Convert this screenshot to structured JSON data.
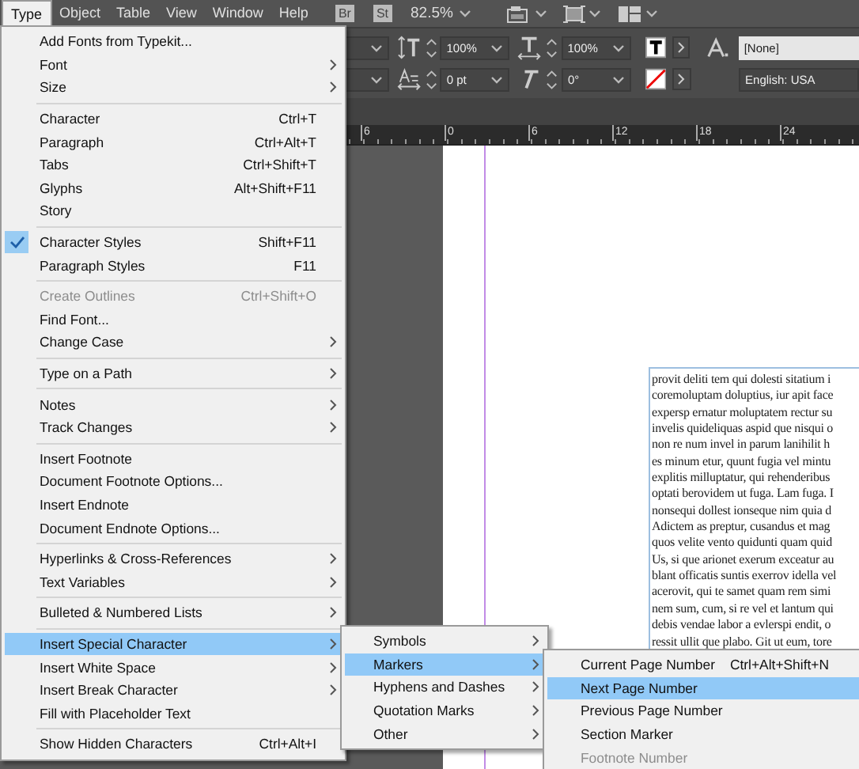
{
  "menubar": {
    "items": [
      {
        "label": "Type",
        "selected": true
      },
      {
        "label": "Object",
        "selected": false
      },
      {
        "label": "Table",
        "selected": false
      },
      {
        "label": "View",
        "selected": false
      },
      {
        "label": "Window",
        "selected": false
      },
      {
        "label": "Help",
        "selected": false
      }
    ],
    "badges": [
      "Br",
      "St"
    ],
    "zoom": "82.5%"
  },
  "control_panel": {
    "rows": [
      {
        "fields": [
          {
            "kind": "spin",
            "value": "100%"
          },
          {
            "kind": "spin",
            "value": "100%"
          },
          {
            "kind": "style",
            "value": "[None]"
          }
        ]
      },
      {
        "fields": [
          {
            "kind": "spin",
            "value": "0 pt"
          },
          {
            "kind": "spin",
            "value": "0°"
          },
          {
            "kind": "language",
            "value": "English: USA"
          }
        ]
      }
    ]
  },
  "ruler": {
    "labels": [
      "6",
      "0",
      "6",
      "12",
      "18",
      "24"
    ]
  },
  "text_frame": {
    "lines": [
      "provit deliti tem qui dolesti sitatium i",
      "coremoluptam doluptius, iur apit face",
      "expersp ernatur moluptatem rectur su",
      "invelis quideliquas aspid que nisqui o",
      "non re num invel in parum lanihilit h",
      "es minum etur, quunt fugia vel mintu",
      "explitis milluptatur, qui rehenderibus",
      "optati berovidem ut fuga. Lam fuga. I",
      "nonsequi dollest ionseque nim quia d",
      "Adictem as preptur, cusandus et mag",
      "quos velite vento quidunti quam quid",
      "Us, si que arionet exerum exceatur au",
      "blant officatis suntis exerrov idella vel",
      "acerovit, qui te samet quam rem simi",
      "nem sum, cum, si re vel et lantum qui",
      "debis vendae labor a evlerspi endit, o",
      "ressit ullit que plabo. Git ut eum, tore"
    ]
  },
  "type_menu": {
    "items": [
      {
        "kind": "item",
        "label": "Add Fonts from Typekit...",
        "submenu": false,
        "checked": false,
        "disabled": false,
        "selected": false
      },
      {
        "kind": "item",
        "label": "Font",
        "submenu": true,
        "checked": false,
        "disabled": false,
        "selected": false
      },
      {
        "kind": "item",
        "label": "Size",
        "submenu": true,
        "checked": false,
        "disabled": false,
        "selected": false
      },
      {
        "kind": "separator"
      },
      {
        "kind": "item",
        "label": "Character",
        "shortcut": "Ctrl+T",
        "submenu": false,
        "checked": false,
        "disabled": false,
        "selected": false
      },
      {
        "kind": "item",
        "label": "Paragraph",
        "shortcut": "Ctrl+Alt+T",
        "submenu": false,
        "checked": false,
        "disabled": false,
        "selected": false
      },
      {
        "kind": "item",
        "label": "Tabs",
        "shortcut": "Ctrl+Shift+T",
        "submenu": false,
        "checked": false,
        "disabled": false,
        "selected": false
      },
      {
        "kind": "item",
        "label": "Glyphs",
        "shortcut": "Alt+Shift+F11",
        "submenu": false,
        "checked": false,
        "disabled": false,
        "selected": false
      },
      {
        "kind": "item",
        "label": "Story",
        "submenu": false,
        "checked": false,
        "disabled": false,
        "selected": false
      },
      {
        "kind": "separator"
      },
      {
        "kind": "item",
        "label": "Character Styles",
        "shortcut": "Shift+F11",
        "submenu": false,
        "checked": true,
        "disabled": false,
        "selected": false
      },
      {
        "kind": "item",
        "label": "Paragraph Styles",
        "shortcut": "F11",
        "submenu": false,
        "checked": false,
        "disabled": false,
        "selected": false
      },
      {
        "kind": "separator"
      },
      {
        "kind": "item",
        "label": "Create Outlines",
        "shortcut": "Ctrl+Shift+O",
        "submenu": false,
        "checked": false,
        "disabled": true,
        "selected": false
      },
      {
        "kind": "item",
        "label": "Find Font...",
        "submenu": false,
        "checked": false,
        "disabled": false,
        "selected": false
      },
      {
        "kind": "item",
        "label": "Change Case",
        "submenu": true,
        "checked": false,
        "disabled": false,
        "selected": false
      },
      {
        "kind": "separator"
      },
      {
        "kind": "item",
        "label": "Type on a Path",
        "submenu": true,
        "checked": false,
        "disabled": false,
        "selected": false
      },
      {
        "kind": "separator"
      },
      {
        "kind": "item",
        "label": "Notes",
        "submenu": true,
        "checked": false,
        "disabled": false,
        "selected": false
      },
      {
        "kind": "item",
        "label": "Track Changes",
        "submenu": true,
        "checked": false,
        "disabled": false,
        "selected": false
      },
      {
        "kind": "separator"
      },
      {
        "kind": "item",
        "label": "Insert Footnote",
        "submenu": false,
        "checked": false,
        "disabled": false,
        "selected": false
      },
      {
        "kind": "item",
        "label": "Document Footnote Options...",
        "submenu": false,
        "checked": false,
        "disabled": false,
        "selected": false
      },
      {
        "kind": "item",
        "label": "Insert Endnote",
        "submenu": false,
        "checked": false,
        "disabled": false,
        "selected": false
      },
      {
        "kind": "item",
        "label": "Document Endnote Options...",
        "submenu": false,
        "checked": false,
        "disabled": false,
        "selected": false
      },
      {
        "kind": "separator"
      },
      {
        "kind": "item",
        "label": "Hyperlinks & Cross-References",
        "submenu": true,
        "checked": false,
        "disabled": false,
        "selected": false
      },
      {
        "kind": "item",
        "label": "Text Variables",
        "submenu": true,
        "checked": false,
        "disabled": false,
        "selected": false
      },
      {
        "kind": "separator"
      },
      {
        "kind": "item",
        "label": "Bulleted & Numbered Lists",
        "submenu": true,
        "checked": false,
        "disabled": false,
        "selected": false
      },
      {
        "kind": "separator"
      },
      {
        "kind": "item",
        "label": "Insert Special Character",
        "submenu": true,
        "checked": false,
        "disabled": false,
        "selected": true
      },
      {
        "kind": "item",
        "label": "Insert White Space",
        "submenu": true,
        "checked": false,
        "disabled": false,
        "selected": false
      },
      {
        "kind": "item",
        "label": "Insert Break Character",
        "submenu": true,
        "checked": false,
        "disabled": false,
        "selected": false
      },
      {
        "kind": "item",
        "label": "Fill with Placeholder Text",
        "submenu": false,
        "checked": false,
        "disabled": false,
        "selected": false
      },
      {
        "kind": "separator"
      },
      {
        "kind": "item",
        "label": "Show Hidden Characters",
        "shortcut": "Ctrl+Alt+I",
        "submenu": false,
        "checked": false,
        "disabled": false,
        "selected": false
      }
    ]
  },
  "special_character_menu": {
    "items": [
      {
        "kind": "item",
        "label": "Symbols",
        "submenu": true,
        "disabled": false,
        "selected": false
      },
      {
        "kind": "item",
        "label": "Markers",
        "submenu": true,
        "disabled": false,
        "selected": true
      },
      {
        "kind": "item",
        "label": "Hyphens and Dashes",
        "submenu": true,
        "disabled": false,
        "selected": false
      },
      {
        "kind": "item",
        "label": "Quotation Marks",
        "submenu": true,
        "disabled": false,
        "selected": false
      },
      {
        "kind": "item",
        "label": "Other",
        "submenu": true,
        "disabled": false,
        "selected": false
      }
    ]
  },
  "markers_menu": {
    "items": [
      {
        "kind": "item",
        "label": "Current Page Number",
        "shortcut": "Ctrl+Alt+Shift+N",
        "submenu": false,
        "disabled": false,
        "selected": false
      },
      {
        "kind": "item",
        "label": "Next Page Number",
        "submenu": false,
        "disabled": false,
        "selected": true
      },
      {
        "kind": "item",
        "label": "Previous Page Number",
        "submenu": false,
        "disabled": false,
        "selected": false
      },
      {
        "kind": "item",
        "label": "Section Marker",
        "submenu": false,
        "disabled": false,
        "selected": false
      },
      {
        "kind": "item",
        "label": "Footnote Number",
        "submenu": false,
        "disabled": true,
        "selected": false
      }
    ]
  }
}
